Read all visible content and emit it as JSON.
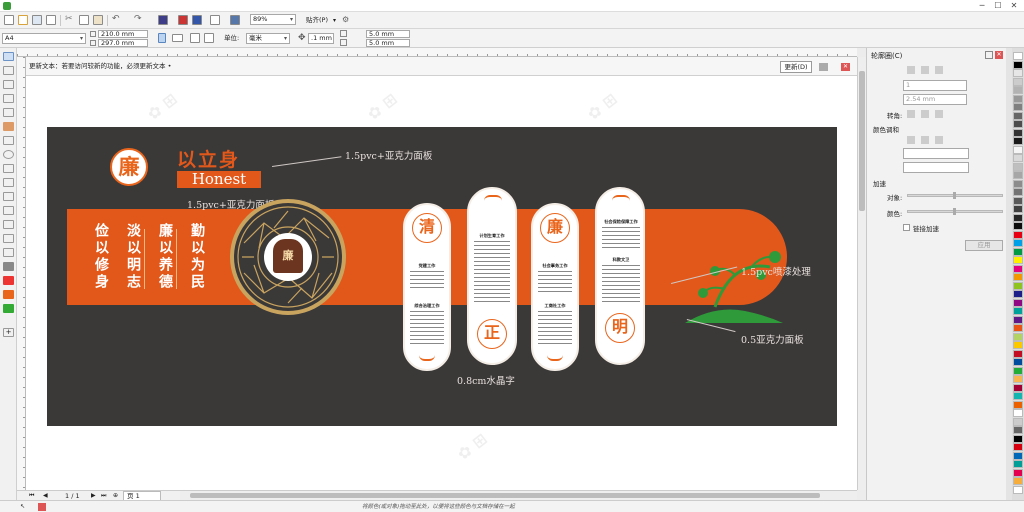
{
  "app": {
    "window_controls": {
      "minimize": "─",
      "maximize": "☐",
      "close": "✕"
    }
  },
  "toolbar1": {
    "zoom_value": "89%",
    "snap_label": "贴齐(P)",
    "icons": [
      "new-icon",
      "open-icon",
      "save-icon",
      "print-icon",
      "cut-icon",
      "copy-icon",
      "paste-icon",
      "undo-icon",
      "redo-icon",
      "import-icon",
      "export-icon",
      "publish-icon",
      "app-launcher-icon",
      "welcome-icon"
    ]
  },
  "toolbar2": {
    "page_size": "A4",
    "width_value": "210.0 mm",
    "height_value": "297.0 mm",
    "unit_label": "单位:",
    "unit_value": "毫米",
    "nudge_value": ".1 mm",
    "dup_x": "5.0 mm",
    "dup_y": "5.0 mm"
  },
  "infobar": {
    "message": "更新文本：若要访问较新的功能，必须更新文本 •",
    "update_button": "更新(D)"
  },
  "design": {
    "brand_char": "廉",
    "headline": "以立身",
    "headline_en": "Honest",
    "bell_char": "廉",
    "mottos": [
      "俭以修身",
      "淡以明志",
      "廉以养德",
      "勤以为民"
    ],
    "pills": [
      {
        "char": "清",
        "titles": [
          "党建工作",
          "综合治理工作"
        ]
      },
      {
        "char": "正",
        "titles": [
          "计划生育工作"
        ]
      },
      {
        "char": "廉",
        "titles": [
          "社会事务工作",
          "工商社工作"
        ]
      },
      {
        "char": "明",
        "titles": [
          "社会保险保障工作",
          "科教文卫"
        ]
      }
    ],
    "callouts": {
      "top": "1.5pvc+亚克力面板",
      "left": "1.5pvc+亚克力面板",
      "right": "1.5pvc喷漆处理",
      "bottom_right": "0.5亚克力面板",
      "bottom": "0.8cm水晶字"
    },
    "colors": {
      "background": "#3b3838",
      "band": "#e2581b",
      "accent": "#e9651c",
      "green": "#2e9a3a"
    }
  },
  "pagebar": {
    "page_counter": "1 / 1",
    "page_tab": "页 1"
  },
  "statusbar": {
    "hint": "将颜色(或对象)拖动至此处，以便将这些颜色与文档存储在一起"
  },
  "docker": {
    "title": "轮廓圈(C)",
    "count_value": "1",
    "width_value": "2.54 mm",
    "rotation_label": "转角:",
    "color_adjust_label": "颜色调和",
    "accel_label": "加速",
    "object_label": "对象:",
    "color_label": "颜色:",
    "link_label": "链接加速",
    "apply_button": "应用"
  },
  "palette": [
    "#ffffff",
    "#000000",
    "#e6e6e6",
    "#cccccc",
    "#b3b3b3",
    "#999999",
    "#808080",
    "#666666",
    "#4d4d4d",
    "#333333",
    "#1a1a1a",
    "#f5f5f5",
    "#d9d9d9",
    "#bfbfbf",
    "#a6a6a6",
    "#8c8c8c",
    "#737373",
    "#595959",
    "#404040",
    "#262626",
    "#0d0d0d",
    "#e60012",
    "#00a0e9",
    "#009944",
    "#fff100",
    "#e4007f",
    "#f39800",
    "#8fc31f",
    "#1d2088",
    "#920783",
    "#00a29a",
    "#601986",
    "#ea5514",
    "#b3d465",
    "#fcc800",
    "#c30d23",
    "#004da0",
    "#22ac38",
    "#f8b551",
    "#a40035",
    "#13b5b1",
    "#eb6100",
    "#ffffff",
    "#cccccc",
    "#666666",
    "#000000",
    "#d7000f",
    "#0068b7",
    "#009e96",
    "#e5004f",
    "#f6ad3c",
    "#ffffff"
  ]
}
